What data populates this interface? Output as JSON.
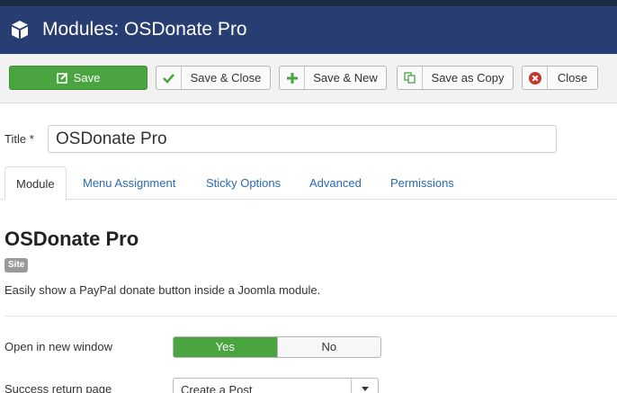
{
  "header": {
    "title": "Modules: OSDonate Pro",
    "icon": "cube-icon"
  },
  "toolbar": {
    "save": {
      "label": "Save",
      "icon": "edit-icon"
    },
    "save_close": {
      "label": "Save & Close",
      "icon": "check-icon"
    },
    "save_new": {
      "label": "Save & New",
      "icon": "plus-icon"
    },
    "save_copy": {
      "label": "Save as Copy",
      "icon": "copy-icon"
    },
    "close": {
      "label": "Close",
      "icon": "close-circle-icon"
    }
  },
  "title_field": {
    "label": "Title *",
    "value": "OSDonate Pro"
  },
  "tabs": [
    {
      "label": "Module",
      "active": true
    },
    {
      "label": "Menu Assignment"
    },
    {
      "label": "Sticky Options"
    },
    {
      "label": "Advanced"
    },
    {
      "label": "Permissions"
    }
  ],
  "module": {
    "name": "OSDonate Pro",
    "badge": "Site",
    "description": "Easily show a PayPal donate button inside a Joomla module."
  },
  "fields": {
    "open_new_window": {
      "label": "Open in new window",
      "yes": "Yes",
      "no": "No",
      "selected": "Yes"
    },
    "success_return_page": {
      "label": "Success return page",
      "value": "Create a Post"
    }
  },
  "colors": {
    "header": "#283e72",
    "success": "#4aa540",
    "link": "#2a69b8",
    "danger": "#c0392b"
  }
}
